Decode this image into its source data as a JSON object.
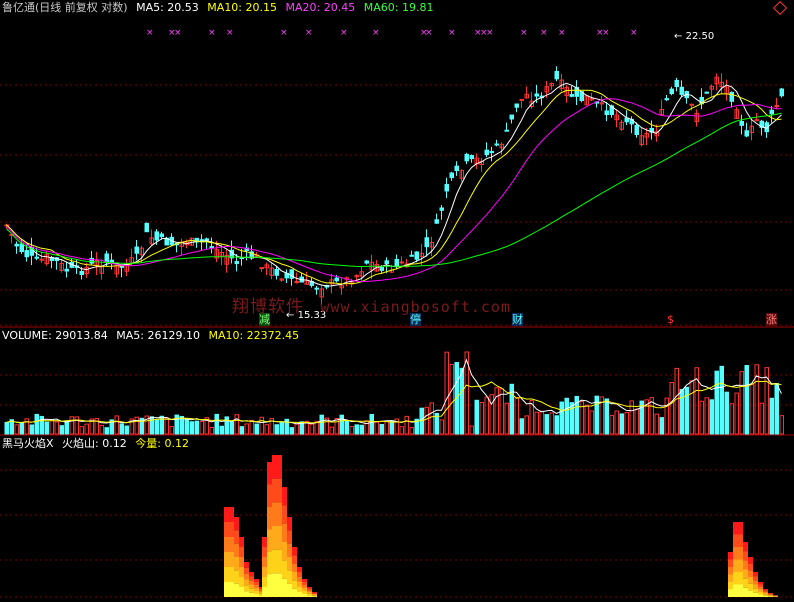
{
  "header": {
    "stock": "鲁亿通(日线 前复权 对数)",
    "ma5": "MA5: 20.53",
    "ma10": "MA10: 20.15",
    "ma20": "MA20: 20.45",
    "ma60": "MA60: 19.81",
    "corner_icon": "diamond-icon"
  },
  "volume_header": {
    "volume": "VOLUME: 29013.84",
    "ma5": "MA5: 26129.10",
    "ma10": "MA10: 22372.45"
  },
  "indicator_header": {
    "name": "黑马火焰X",
    "flame": "火焰山: 0.12",
    "today": "今量: 0.12"
  },
  "annotations": {
    "high": "22.50",
    "low": "15.33",
    "high_arrow": "←",
    "low_arrow": "←"
  },
  "watermark": {
    "name": "翔博软件",
    "site": "www.xiangbosoft.com"
  },
  "event_tags": [
    {
      "label": "减",
      "color": "#5cff5c"
    },
    {
      "label": "停",
      "color": "#54ffff"
    },
    {
      "label": "财",
      "color": "#54ffff"
    },
    {
      "label": "$",
      "color": "#ff3030"
    },
    {
      "label": "涨",
      "color": "#ff6060"
    }
  ],
  "colors": {
    "up": "#ff3232",
    "down": "#54ffff",
    "ma5": "#ffffff",
    "ma10": "#ffff00",
    "ma20": "#ff00ff",
    "ma60": "#00ff00",
    "grid": "#7a0000",
    "marker": "#ff40ff"
  }
}
